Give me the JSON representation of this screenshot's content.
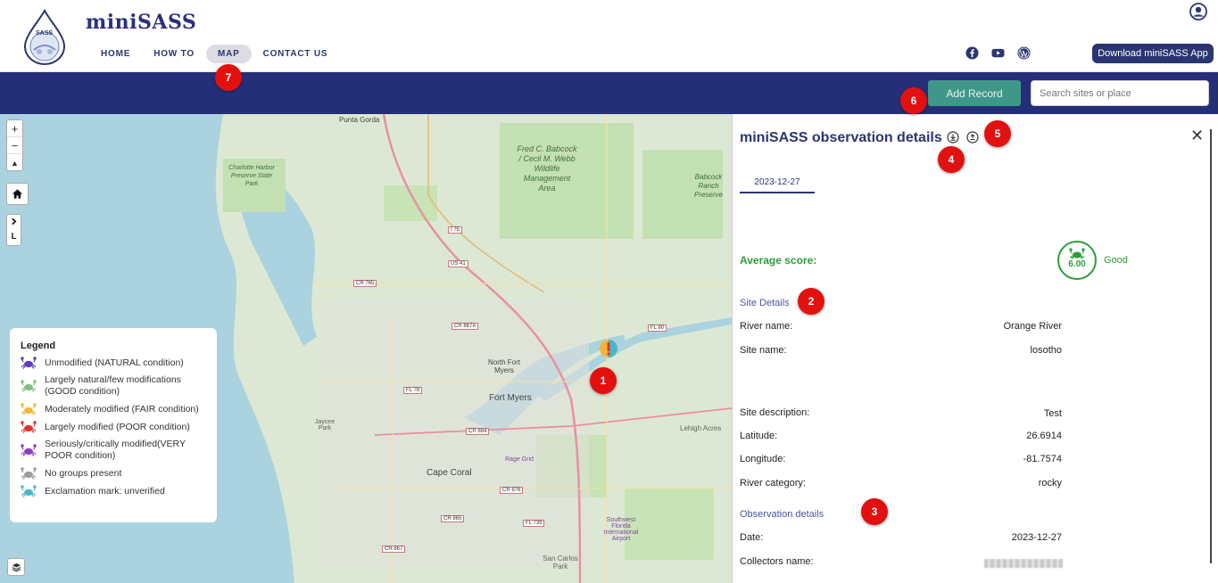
{
  "header": {
    "brand": "miniSASS",
    "logo_text": "SASS",
    "nav": [
      "HOME",
      "HOW TO",
      "MAP",
      "CONTACT US"
    ],
    "active_nav": "MAP",
    "social_icons": [
      "facebook-icon",
      "youtube-icon",
      "wordpress-icon"
    ],
    "download_label": "Download miniSASS App",
    "user_icon": "user-circle-icon"
  },
  "toolbar": {
    "add_record_label": "Add Record",
    "search_placeholder": "Search sites or place"
  },
  "map": {
    "zoom_in": "+",
    "zoom_out": "−",
    "reset_north": "▲",
    "side_toggle": "L",
    "labels": {
      "punta_gorda": "Punta Gorda",
      "preserve1": "Charlotte Harbor Preserve State Park",
      "wildlife": "Fred C. Babcock / Cecil M. Webb Wildlife Management Area",
      "babcock": "Babcock Ranch Preserve",
      "north_fort_myers": "North Fort Myers",
      "fort_myers": "Fort Myers",
      "cape_coral": "Cape Coral",
      "lehigh": "Lehigh Acres",
      "san_carlos": "San Carlos Park",
      "jaycee": "Jaycee Park",
      "rage": "Rage Grid",
      "airport": "Southwest Florida International Airport"
    },
    "shields": [
      "I 75",
      "US 41",
      "CR 765",
      "CR 867A",
      "FL 78",
      "CR 884",
      "CR 876",
      "CR 865",
      "FL 739",
      "CR 867",
      "FL 80"
    ]
  },
  "legend": {
    "title": "Legend",
    "items": [
      {
        "label": "Unmodified (NATURAL condition)",
        "color": "#5b3bbf"
      },
      {
        "label": "Largely natural/few modifications (GOOD condition)",
        "color": "#7fbf7f"
      },
      {
        "label": "Moderately modified (FAIR condition)",
        "color": "#f2b43a"
      },
      {
        "label": "Largely modified (POOR condition)",
        "color": "#e0342a"
      },
      {
        "label": "Seriously/critically modified(VERY POOR condition)",
        "color": "#8e3fc0"
      },
      {
        "label": "No groups present",
        "color": "#9b9b9b"
      },
      {
        "label": "Exclamation mark: unverified",
        "color": "#48b8c8"
      }
    ]
  },
  "badges": [
    "1",
    "2",
    "3",
    "4",
    "5",
    "6",
    "7"
  ],
  "panel": {
    "title": "miniSASS observation details",
    "icons": [
      "download-icon",
      "share-icon"
    ],
    "close": "✕",
    "date_tab": "2023-12-27",
    "average_label": "Average score:",
    "score": "6.00",
    "score_word": "Good",
    "site_details_heading": "Site Details",
    "site_rows": [
      {
        "label": "River name:",
        "value": "Orange River"
      },
      {
        "label": "Site name:",
        "value": "losotho"
      },
      {
        "label": "Site description:",
        "value": "Test"
      },
      {
        "label": "Latitude:",
        "value": "26.6914"
      },
      {
        "label": "Longitude:",
        "value": "-81.7574"
      },
      {
        "label": "River category:",
        "value": "rocky"
      }
    ],
    "observation_heading": "Observation details",
    "obs_rows": [
      {
        "label": "Date:",
        "value": "2023-12-27"
      },
      {
        "label": "Collectors name:",
        "value": ""
      }
    ]
  },
  "colors": {
    "navy": "#252f77",
    "teal": "#3f978a",
    "good": "#2a9d3a",
    "badge": "#e31010"
  }
}
